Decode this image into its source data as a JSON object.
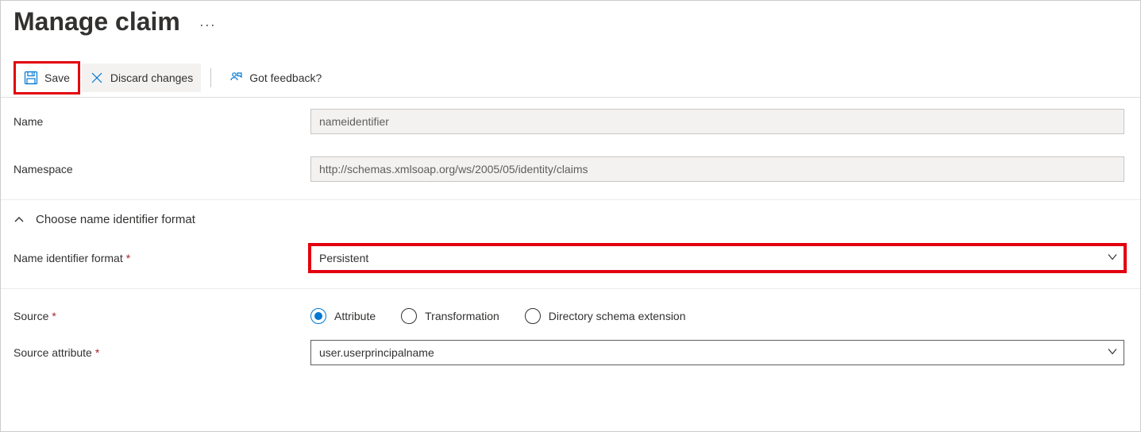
{
  "header": {
    "title": "Manage claim"
  },
  "toolbar": {
    "save_label": "Save",
    "discard_label": "Discard changes",
    "feedback_label": "Got feedback?"
  },
  "form": {
    "name": {
      "label": "Name",
      "value": "nameidentifier"
    },
    "namespace": {
      "label": "Namespace",
      "value": "http://schemas.xmlsoap.org/ws/2005/05/identity/claims"
    },
    "section_header": "Choose name identifier format",
    "name_id_format": {
      "label": "Name identifier format",
      "value": "Persistent"
    },
    "source": {
      "label": "Source",
      "options": {
        "attribute": "Attribute",
        "transformation": "Transformation",
        "directory": "Directory schema extension"
      },
      "selected": "attribute"
    },
    "source_attribute": {
      "label": "Source attribute",
      "value": "user.userprincipalname"
    }
  }
}
